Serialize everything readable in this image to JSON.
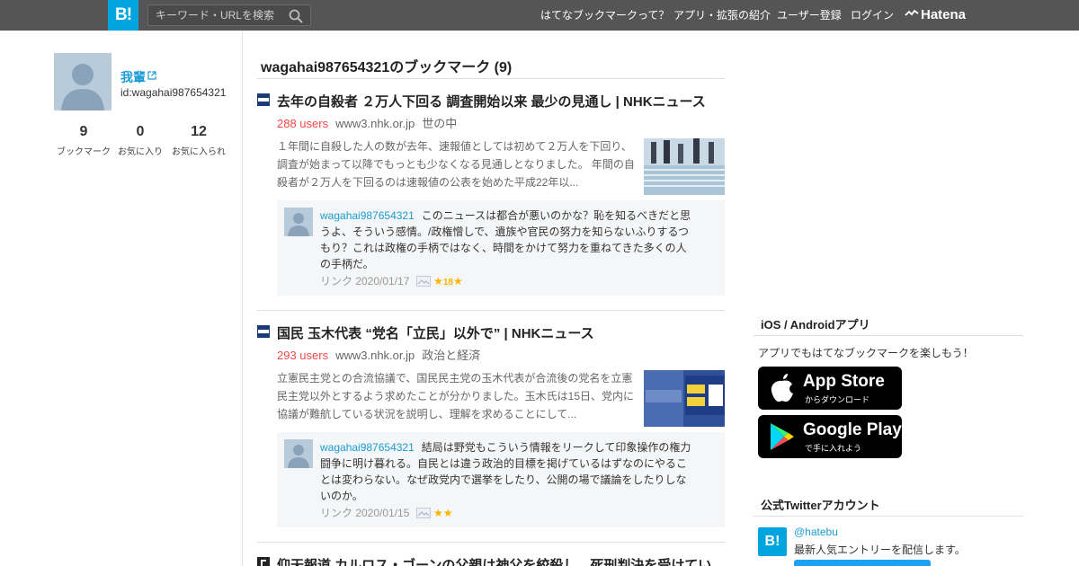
{
  "header": {
    "logo": "B!",
    "search_placeholder": "キーワード・URLを検索",
    "nav": [
      "はてなブックマークって？",
      "アプリ・拡張の紹介",
      "ユーザー登録",
      "ログイン"
    ],
    "brand": "Hatena"
  },
  "profile": {
    "name": "我輩",
    "id": "id:wagahai987654321",
    "stats": [
      {
        "num": "9",
        "label": "ブックマーク"
      },
      {
        "num": "0",
        "label": "お気に入り"
      },
      {
        "num": "12",
        "label": "お気に入られ"
      }
    ]
  },
  "main": {
    "title": "wagahai987654321のブックマーク (9)",
    "entries": [
      {
        "title": "去年の自殺者 ２万人下回る 調査開始以来 最少の見通し | NHKニュース",
        "users": "288 users",
        "domain": "www3.nhk.or.jp",
        "category": "世の中",
        "summary": "１年間に自殺した人の数が去年、速報値としては初めて２万人を下回り、調査が始まって以降でもっとも少なくなる見通しとなりました。 年間の自殺者が２万人を下回るのは速報値の公表を始めた平成22年以...",
        "comment_user": "wagahai987654321",
        "comment": "このニュースは都合が悪いのかな？恥を知るべきだと思うよ、そういう感情。/政権憎しで、遺族や官民の努力を知らないふりするつもり？これは政権の手柄ではなく、時間をかけて努力を重ねてきた多くの人の手柄だ。",
        "comment_meta": "リンク 2020/01/17",
        "star_count": "18"
      },
      {
        "title": "国民 玉木代表 “党名「立民」以外で” | NHKニュース",
        "users": "293 users",
        "domain": "www3.nhk.or.jp",
        "category": "政治と経済",
        "summary": "立憲民主党との合流協議で、国民民主党の玉木代表が合流後の党名を立憲民主党以外とするよう求めたことが分かりました。玉木氏は15日、党内に協議が難航している状況を説明し、理解を求めることにして...",
        "comment_user": "wagahai987654321",
        "comment": "結局は野党もこういう情報をリークして印象操作の権力闘争に明け暮れる。自民とは違う政治的目標を掲げているはずなのにやることは変わらない。なぜ政党内で選挙をしたり、公開の場で議論をしたりしないのか。",
        "comment_meta": "リンク 2020/01/15"
      },
      {
        "title": "仰天報道 カルロス・ゴーンの父親は神父を絞殺し、死刑判決を受けてい"
      }
    ]
  },
  "sidebar": {
    "app_heading": "iOS / Androidアプリ",
    "app_text": "アプリでもはてなブックマークを楽しもう！",
    "appstore_big": "App Store",
    "appstore_small": "からダウンロード",
    "gplay_big": "Google Play",
    "gplay_small": "で手に入れよう",
    "twitter_heading": "公式Twitterアカウント",
    "twitter_handle": "@hatebu",
    "twitter_desc": "最新人気エントリーを配信します。"
  },
  "colors": {
    "topbar": "#555555",
    "brand_blue": "#00a4de",
    "link_blue": "#1a9bd5",
    "users_red": "#f54747",
    "star": "#f7b500"
  }
}
